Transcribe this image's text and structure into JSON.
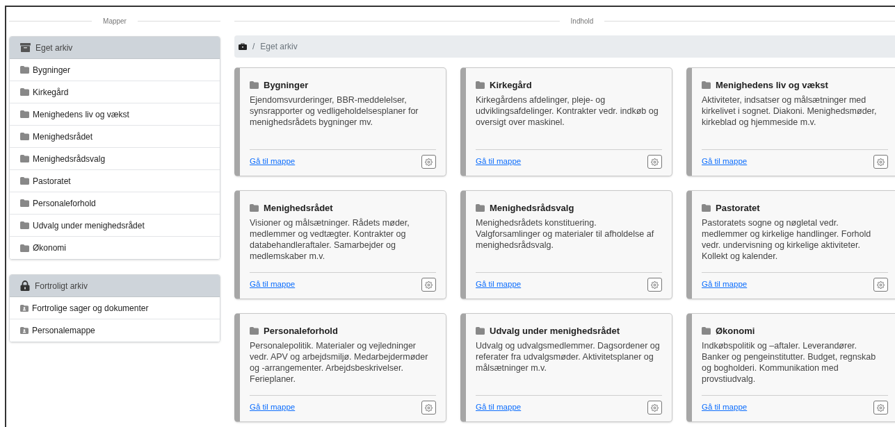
{
  "sidebar": {
    "heading": "Mapper",
    "sections": [
      {
        "title": "Eget arkiv",
        "kind": "archive",
        "items": [
          {
            "label": "Bygninger",
            "kind": "folder"
          },
          {
            "label": "Kirkegård",
            "kind": "folder"
          },
          {
            "label": "Menighedens liv og vækst",
            "kind": "folder"
          },
          {
            "label": "Menighedsrådet",
            "kind": "folder"
          },
          {
            "label": "Menighedsrådsvalg",
            "kind": "folder"
          },
          {
            "label": "Pastoratet",
            "kind": "folder"
          },
          {
            "label": "Personaleforhold",
            "kind": "folder"
          },
          {
            "label": "Udvalg under menighedsrådet",
            "kind": "folder"
          },
          {
            "label": "Økonomi",
            "kind": "folder"
          }
        ]
      },
      {
        "title": "Fortroligt arkiv",
        "kind": "locked",
        "items": [
          {
            "label": "Fortrolige sager og dokumenter",
            "kind": "person-folder"
          },
          {
            "label": "Personalemappe",
            "kind": "person-folder"
          }
        ]
      }
    ]
  },
  "content": {
    "heading": "Indhold",
    "breadcrumb_separator": "/",
    "breadcrumb": [
      "Eget arkiv"
    ],
    "cards": [
      {
        "title": "Bygninger",
        "description": "Ejendomsvurderinger, BBR-meddelelser, synsrapporter og vedligeholdelsesplaner for menighedsrådets bygninger mv.",
        "link": "Gå til mappe"
      },
      {
        "title": "Kirkegård",
        "description": "Kirkegårdens afdelinger, pleje- og udviklingsafdelinger. Kontrakter vedr. indkøb og oversigt over maskinel.",
        "link": "Gå til mappe"
      },
      {
        "title": "Menighedens liv og vækst",
        "description": "Aktiviteter, indsatser og målsætninger med kirkelivet i sognet. Diakoni. Menighedsmøder, kirkeblad og hjemmeside m.v.",
        "link": "Gå til mappe"
      },
      {
        "title": "Menighedsrådet",
        "description": "Visioner og målsætninger. Rådets møder, medlemmer og vedtægter. Kontrakter og databehandleraftaler. Samarbejder og medlemskaber m.v.",
        "link": "Gå til mappe"
      },
      {
        "title": "Menighedsrådsvalg",
        "description": "Menighedsrådets konstituering. Valgforsamlinger og materialer til afholdelse af menighedsrådsvalg.",
        "link": "Gå til mappe"
      },
      {
        "title": "Pastoratet",
        "description": "Pastoratets sogne og nøgletal vedr. medlemmer og kirkelige handlinger. Forhold vedr. undervisning og kirkelige aktiviteter. Kollekt og kalender.",
        "link": "Gå til mappe"
      },
      {
        "title": "Personaleforhold",
        "description": "Personalepolitik. Materialer og vejledninger vedr. APV og arbejdsmiljø. Medarbejdermøder og -arrangementer. Arbejdsbeskrivelser. Ferieplaner.",
        "link": "Gå til mappe"
      },
      {
        "title": "Udvalg under menighedsrådet",
        "description": "Udvalg og udvalgsmedlemmer. Dagsordener og referater fra udvalgsmøder. Aktivitetsplaner og målsætninger m.v.",
        "link": "Gå til mappe"
      },
      {
        "title": "Økonomi",
        "description": "Indkøbspolitik og –aftaler. Leverandører. Banker og pengeinstitutter. Budget, regnskab og bogholderi. Kommunikation med provstiudvalg.",
        "link": "Gå til mappe"
      }
    ]
  }
}
